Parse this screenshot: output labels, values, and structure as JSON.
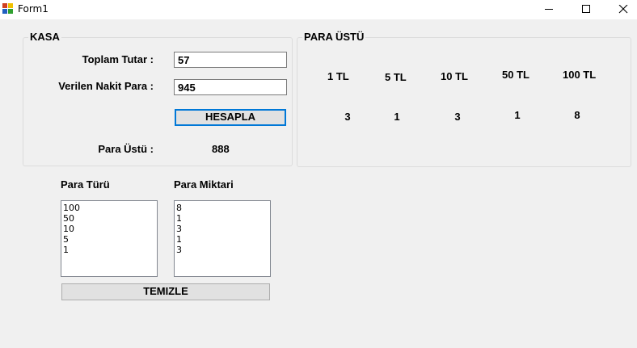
{
  "window": {
    "title": "Form1"
  },
  "kasa": {
    "legend": "KASA",
    "toplam_label": "Toplam Tutar :",
    "toplam_value": "57",
    "verilen_label": "Verilen Nakit Para :",
    "verilen_value": "945",
    "hesapla_button": "HESAPLA",
    "para_ustu_label": "Para Üstü :",
    "para_ustu_value": "888"
  },
  "para_ustu": {
    "legend": "PARA ÜSTÜ",
    "headers": [
      "1 TL",
      "5 TL",
      "10 TL",
      "50 TL",
      "100 TL"
    ],
    "counts": [
      "3",
      "1",
      "3",
      "1",
      "8"
    ]
  },
  "lists": {
    "turu_label": "Para Türü",
    "turu_items": [
      "100",
      "50",
      "10",
      "5",
      "1"
    ],
    "miktari_label": "Para Miktari",
    "miktari_items": [
      "8",
      "1",
      "3",
      "1",
      "3"
    ]
  },
  "temizle_button": "TEMIZLE",
  "colors": {
    "focus_border": "#0078d7",
    "background": "#f0f0f0"
  }
}
